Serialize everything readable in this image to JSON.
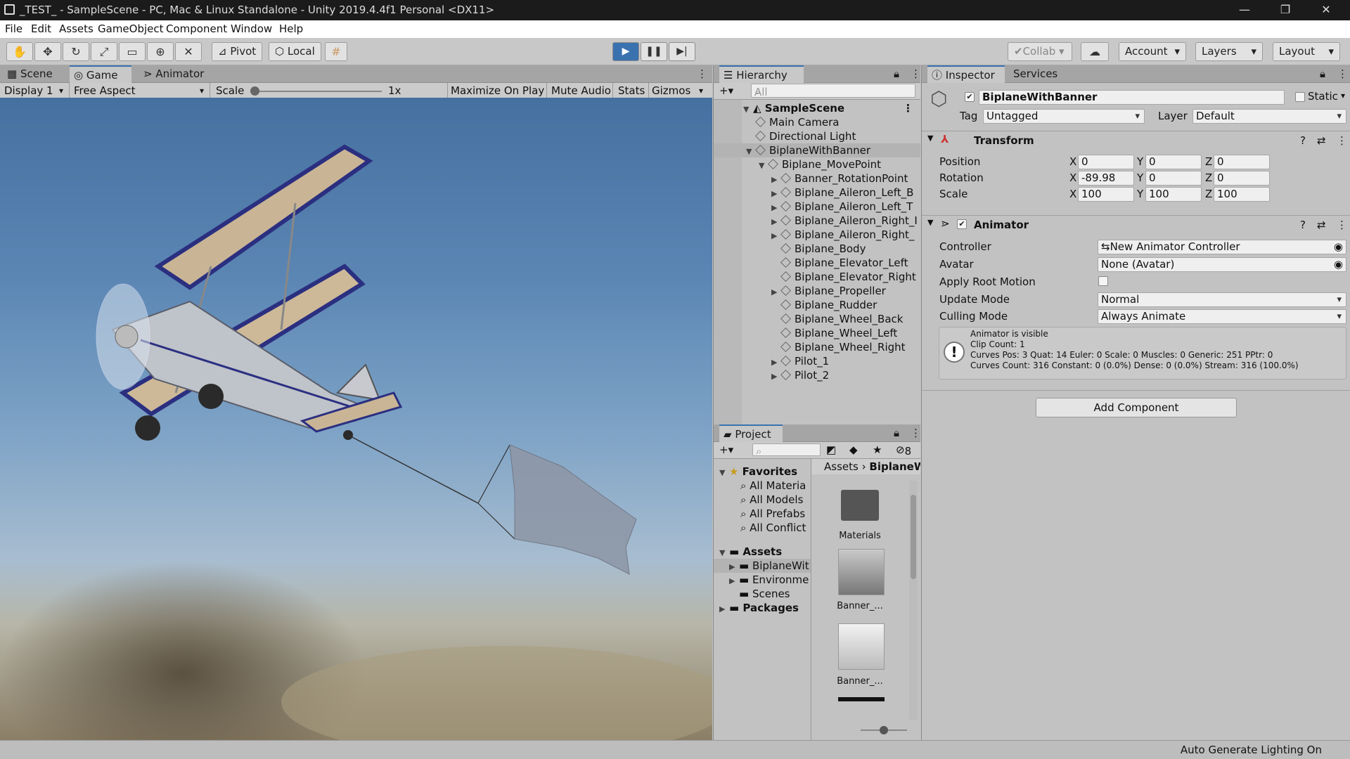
{
  "window": {
    "title": "_TEST_ - SampleScene - PC, Mac & Linux Standalone - Unity 2019.4.4f1 Personal <DX11>"
  },
  "menu": [
    "File",
    "Edit",
    "Assets",
    "GameObject",
    "Component",
    "Window",
    "Help"
  ],
  "toolbar": {
    "pivot_label": "Pivot",
    "local_label": "Local",
    "collab_label": "Collab",
    "account_label": "Account",
    "layers_label": "Layers",
    "layout_label": "Layout",
    "play_icon": "play-icon",
    "accent": "#3a72b0"
  },
  "game_view": {
    "tabs": [
      "Scene",
      "Game",
      "Animator"
    ],
    "display": "Display 1",
    "aspect": "Free Aspect",
    "scale_label": "Scale",
    "scale_value": "1x",
    "maximize": "Maximize On Play",
    "mute": "Mute Audio",
    "stats": "Stats",
    "gizmos": "Gizmos"
  },
  "hierarchy": {
    "tab": "Hierarchy",
    "search_placeholder": "All",
    "scene": "SampleScene",
    "items": [
      {
        "label": "Main Camera",
        "depth": 1,
        "arrow": ""
      },
      {
        "label": "Directional Light",
        "depth": 1,
        "arrow": ""
      },
      {
        "label": "BiplaneWithBanner",
        "depth": 1,
        "arrow": "▼",
        "selected": true
      },
      {
        "label": "Biplane_MovePoint",
        "depth": 2,
        "arrow": "▼"
      },
      {
        "label": "Banner_RotationPoint",
        "depth": 3,
        "arrow": "▶"
      },
      {
        "label": "Biplane_Aileron_Left_B",
        "depth": 3,
        "arrow": "▶"
      },
      {
        "label": "Biplane_Aileron_Left_T",
        "depth": 3,
        "arrow": "▶"
      },
      {
        "label": "Biplane_Aileron_Right_I",
        "depth": 3,
        "arrow": "▶"
      },
      {
        "label": "Biplane_Aileron_Right_",
        "depth": 3,
        "arrow": "▶"
      },
      {
        "label": "Biplane_Body",
        "depth": 3,
        "arrow": ""
      },
      {
        "label": "Biplane_Elevator_Left",
        "depth": 3,
        "arrow": ""
      },
      {
        "label": "Biplane_Elevator_Right",
        "depth": 3,
        "arrow": ""
      },
      {
        "label": "Biplane_Propeller",
        "depth": 3,
        "arrow": "▶"
      },
      {
        "label": "Biplane_Rudder",
        "depth": 3,
        "arrow": ""
      },
      {
        "label": "Biplane_Wheel_Back",
        "depth": 3,
        "arrow": ""
      },
      {
        "label": "Biplane_Wheel_Left",
        "depth": 3,
        "arrow": ""
      },
      {
        "label": "Biplane_Wheel_Right",
        "depth": 3,
        "arrow": ""
      },
      {
        "label": "Pilot_1",
        "depth": 3,
        "arrow": "▶"
      },
      {
        "label": "Pilot_2",
        "depth": 3,
        "arrow": "▶"
      }
    ]
  },
  "project": {
    "tab": "Project",
    "hidden_count": "8",
    "favorites_label": "Favorites",
    "favorites": [
      "All Materia",
      "All Models",
      "All Prefabs",
      "All Conflict"
    ],
    "assets_label": "Assets",
    "assets": [
      "BiplaneWit",
      "Environme",
      "Scenes"
    ],
    "packages_label": "Packages",
    "breadcrumb": [
      "Assets",
      "BiplaneWit"
    ],
    "grid": [
      "Materials",
      "Banner_...",
      "Banner_..."
    ]
  },
  "inspector": {
    "tabs": [
      "Inspector",
      "Services"
    ],
    "object_name": "BiplaneWithBanner",
    "static_label": "Static",
    "tag_label": "Tag",
    "tag_value": "Untagged",
    "layer_label": "Layer",
    "layer_value": "Default",
    "transform": {
      "title": "Transform",
      "rows": [
        {
          "label": "Position",
          "x": "0",
          "y": "0",
          "z": "0"
        },
        {
          "label": "Rotation",
          "x": "-89.98",
          "y": "0",
          "z": "0"
        },
        {
          "label": "Scale",
          "x": "100",
          "y": "100",
          "z": "100"
        }
      ]
    },
    "animator": {
      "title": "Animator",
      "controller_label": "Controller",
      "controller_value": "New Animator Controller",
      "avatar_label": "Avatar",
      "avatar_value": "None (Avatar)",
      "root_motion_label": "Apply Root Motion",
      "update_label": "Update Mode",
      "update_value": "Normal",
      "culling_label": "Culling Mode",
      "culling_value": "Always Animate",
      "info": [
        "Animator is visible",
        "Clip Count: 1",
        "Curves Pos: 3 Quat: 14 Euler: 0 Scale: 0 Muscles: 0 Generic: 251 PPtr: 0",
        "Curves Count: 316 Constant: 0 (0.0%) Dense: 0 (0.0%) Stream: 316 (100.0%)"
      ]
    },
    "add_component": "Add Component"
  },
  "status": {
    "text": "Auto Generate Lighting On"
  }
}
